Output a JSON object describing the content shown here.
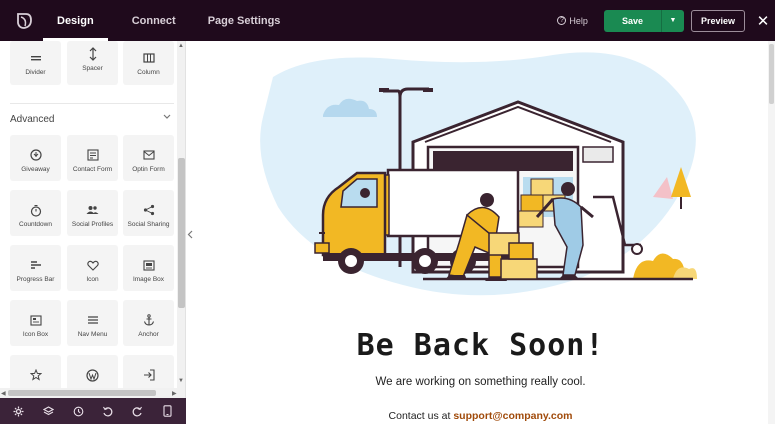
{
  "topbar": {
    "tabs": [
      {
        "label": "Design",
        "active": true
      },
      {
        "label": "Connect",
        "active": false
      },
      {
        "label": "Page Settings",
        "active": false
      }
    ],
    "help_label": "Help",
    "save_label": "Save",
    "preview_label": "Preview",
    "save_color": "#1a8a52",
    "bar_color": "#1f0a1c"
  },
  "sidebar": {
    "basic_blocks": [
      {
        "label": "Divider",
        "icon": "divider-icon"
      },
      {
        "label": "Spacer",
        "icon": "spacer-icon"
      },
      {
        "label": "Column",
        "icon": "column-icon"
      }
    ],
    "advanced": {
      "title": "Advanced",
      "blocks": [
        {
          "label": "Giveaway",
          "icon": "giveaway-icon"
        },
        {
          "label": "Contact Form",
          "icon": "contact-form-icon"
        },
        {
          "label": "Optin Form",
          "icon": "mail-icon"
        },
        {
          "label": "Countdown",
          "icon": "stopwatch-icon"
        },
        {
          "label": "Social Profiles",
          "icon": "people-icon"
        },
        {
          "label": "Social Sharing",
          "icon": "share-icon"
        },
        {
          "label": "Progress Bar",
          "icon": "progress-bar-icon"
        },
        {
          "label": "Icon",
          "icon": "heart-icon"
        },
        {
          "label": "Image Box",
          "icon": "image-box-icon"
        },
        {
          "label": "Icon Box",
          "icon": "icon-box-icon"
        },
        {
          "label": "Nav Menu",
          "icon": "menu-icon"
        },
        {
          "label": "Anchor",
          "icon": "anchor-icon"
        },
        {
          "label": "",
          "icon": "star-icon"
        },
        {
          "label": "",
          "icon": "wordpress-icon"
        },
        {
          "label": "",
          "icon": "login-icon"
        }
      ]
    },
    "bottom_icons": [
      "settings-icon",
      "layers-icon",
      "history-icon",
      "undo-icon",
      "redo-icon",
      "mobile-preview-icon"
    ]
  },
  "canvas": {
    "headline": "Be Back Soon!",
    "subline": "We are working on something really cool.",
    "contact_prefix": "Contact us at",
    "contact_email": "support@company.com",
    "email_color": "#a04a0a"
  }
}
